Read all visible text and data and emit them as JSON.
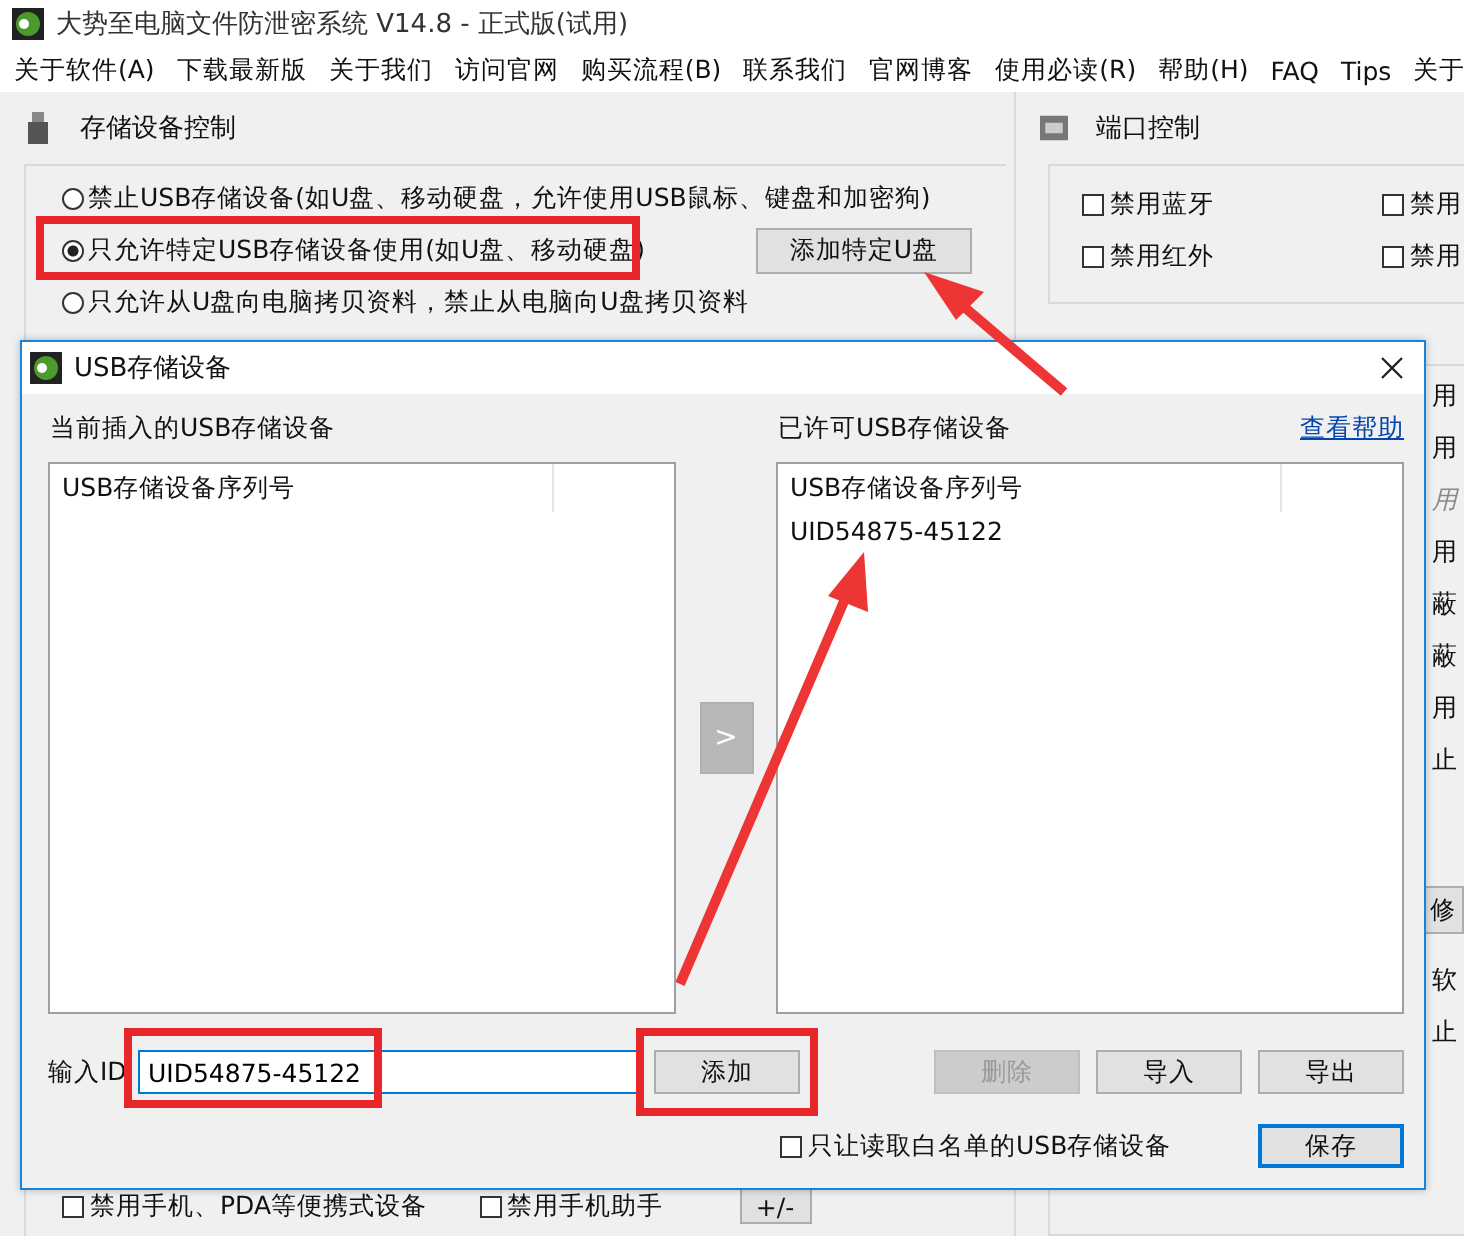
{
  "window": {
    "title": "大势至电脑文件防泄密系统 V14.8 - 正式版(试用)"
  },
  "menu": [
    "关于软件(A)",
    "下载最新版",
    "关于我们",
    "访问官网",
    "购买流程(B)",
    "联系我们",
    "官网博客",
    "使用必读(R)",
    "帮助(H)",
    "FAQ",
    "Tips",
    "关于"
  ],
  "storage_panel": {
    "title": "存储设备控制",
    "add_button": "添加特定U盘",
    "options": [
      {
        "label": "禁止USB存储设备(如U盘、移动硬盘，允许使用USB鼠标、键盘和加密狗)",
        "selected": false
      },
      {
        "label": "只允许特定USB存储设备使用(如U盘、移动硬盘)",
        "selected": true
      },
      {
        "label": "只允许从U盘向电脑拷贝资料，禁止从电脑向U盘拷贝资料",
        "selected": false
      }
    ],
    "bottom_checkboxes": [
      {
        "label": "禁用手机、PDA等便携式设备",
        "checked": false
      },
      {
        "label": "禁用手机助手",
        "checked": false
      }
    ],
    "bottom_button": "+/-"
  },
  "port_panel": {
    "title": "端口控制",
    "checkboxes": [
      {
        "label": "禁用蓝牙",
        "checked": false
      },
      {
        "label": "禁用",
        "checked": false
      },
      {
        "label": "禁用红外",
        "checked": false
      },
      {
        "label": "禁用",
        "checked": false
      }
    ]
  },
  "right_fragments": [
    {
      "kind": "text",
      "text": "用",
      "disabled": false
    },
    {
      "kind": "text",
      "text": "用",
      "disabled": false
    },
    {
      "kind": "text",
      "text": "用",
      "disabled": true
    },
    {
      "kind": "text",
      "text": "用",
      "disabled": false
    },
    {
      "kind": "text",
      "text": "蔽",
      "disabled": false
    },
    {
      "kind": "text",
      "text": "蔽",
      "disabled": false
    },
    {
      "kind": "text",
      "text": "用",
      "disabled": false
    },
    {
      "kind": "text",
      "text": "止",
      "disabled": false
    },
    {
      "kind": "button",
      "text": "修",
      "disabled": false
    },
    {
      "kind": "text",
      "text": "软",
      "disabled": false
    },
    {
      "kind": "text",
      "text": "止",
      "disabled": false
    }
  ],
  "dialog": {
    "title": "USB存储设备",
    "left_label": "当前插入的USB存储设备",
    "left_list": {
      "column": "USB存储设备序列号"
    },
    "right_label": "已许可USB存储设备",
    "help_link": "查看帮助",
    "right_list": {
      "column": "USB存储设备序列号",
      "rows": [
        "UID54875-45122"
      ]
    },
    "transfer_button": ">",
    "input_label": "输入ID",
    "input_value": "UID54875-45122",
    "add_button": "添加",
    "buttons": [
      {
        "label": "删除",
        "disabled": true
      },
      {
        "label": "导入",
        "disabled": false
      },
      {
        "label": "导出",
        "disabled": false
      }
    ],
    "whitelist_checkbox": {
      "label": "只让读取白名单的USB存储设备",
      "checked": false
    },
    "save_button": "保存"
  }
}
